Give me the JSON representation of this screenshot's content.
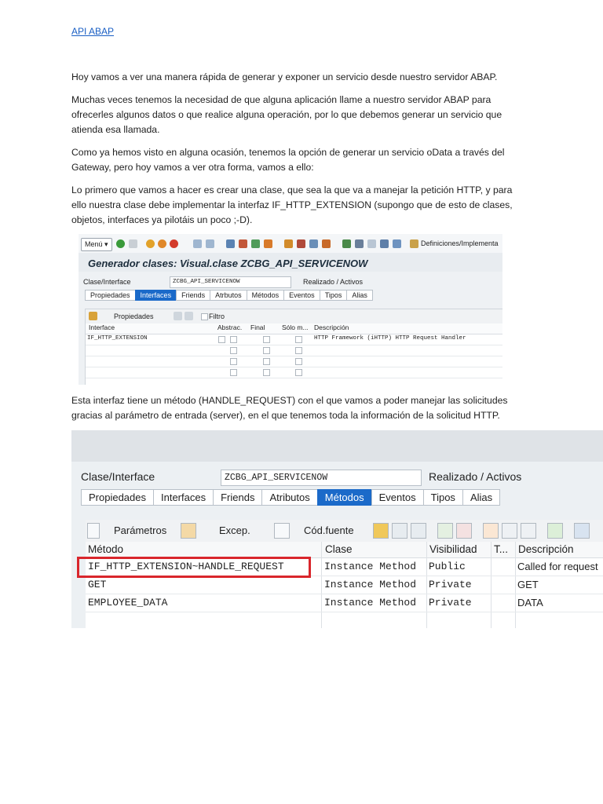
{
  "doc": {
    "link": "API ABAP",
    "paragraphs": [
      "Hoy vamos a ver una manera rápida de generar y exponer un servicio desde nuestro servidor ABAP.",
      "Muchas veces tenemos la necesidad de que alguna aplicación llame a nuestro servidor ABAP para ofrecerles algunos datos o que realice alguna operación, por lo que debemos generar un servicio que atienda esa llamada.",
      "Como ya hemos visto en alguna ocasión, tenemos la opción de generar un servicio oData a través del Gateway, pero hoy vamos a ver otra forma, vamos a ello:",
      "Lo primero que vamos a hacer es crear una clase, que sea la que va a manejar la petición HTTP, y para ello nuestra clase debe implementar la interfaz IF_HTTP_EXTENSION (supongo que de esto de clases, objetos, interfaces ya pilotáis un poco ;-D).",
      "Esta interfaz tiene un método (HANDLE_REQUEST) con el que vamos a poder manejar las solicitudes gracias al parámetro de entrada (server), en el que tenemos toda la información de la solicitud HTTP."
    ]
  },
  "shot1": {
    "menu": "Menú",
    "definitions": "Definiciones/Implementa",
    "title": "Generador clases: Visual.clase ZCBG_API_SERVICENOW",
    "class_label": "Clase/Interface",
    "class_value": "ZCBG_API_SERVICENOW",
    "status": "Realizado / Activos",
    "tabs": [
      "Propiedades",
      "Interfaces",
      "Friends",
      "Atrbutos",
      "Métodos",
      "Eventos",
      "Tipos",
      "Alias"
    ],
    "props_button": "Propiedades",
    "filter": "Filtro",
    "columns": [
      "Interface",
      "Abstrac.",
      "Final",
      "Sólo m...",
      "Descripción"
    ],
    "row": {
      "interface": "IF_HTTP_EXTENSION",
      "description": "HTTP Framework (iHTTP) HTTP Request Handler"
    }
  },
  "shot2": {
    "class_label": "Clase/Interface",
    "class_value": "ZCBG_API_SERVICENOW",
    "status": "Realizado / Activos",
    "tabs": [
      "Propiedades",
      "Interfaces",
      "Friends",
      "Atributos",
      "Métodos",
      "Eventos",
      "Tipos",
      "Alias"
    ],
    "buttons": [
      "Parámetros",
      "Excep.",
      "Cód.fuente"
    ],
    "columns": [
      "Método",
      "Clase",
      "Visibilidad",
      "T...",
      "Descripción"
    ],
    "rows": [
      {
        "method": "IF_HTTP_EXTENSION~HANDLE_REQUEST",
        "type": "Instance Method",
        "visibility": "Public",
        "description": "Called for request"
      },
      {
        "method": "GET",
        "type": "Instance Method",
        "visibility": "Private",
        "description": "GET"
      },
      {
        "method": "EMPLOYEE_DATA",
        "type": "Instance Method",
        "visibility": "Private",
        "description": "DATA"
      }
    ]
  },
  "colors": {
    "accent": "#1b6ac9",
    "highlight": "#d9262c",
    "link": "#1a5fc4"
  }
}
